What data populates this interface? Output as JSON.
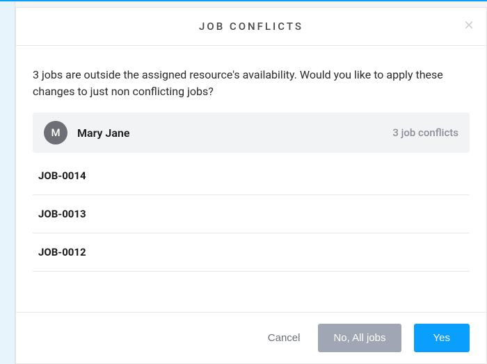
{
  "modal": {
    "title": "JOB CONFLICTS",
    "close_glyph": "×",
    "prompt": "3 jobs are outside the assigned resource's availability. Would you like to apply these changes to just non conflicting jobs?",
    "resource": {
      "avatar_initial": "M",
      "name": "Mary Jane",
      "conflict_summary": "3 job conflicts"
    },
    "jobs": [
      {
        "id": "JOB-0014"
      },
      {
        "id": "JOB-0013"
      },
      {
        "id": "JOB-0012"
      }
    ],
    "footer": {
      "cancel": "Cancel",
      "no_all": "No, All jobs",
      "yes": "Yes"
    }
  },
  "colors": {
    "accent": "#0a9fff",
    "secondary_btn": "#a0a6b3",
    "avatar_bg": "#6e6e76"
  }
}
